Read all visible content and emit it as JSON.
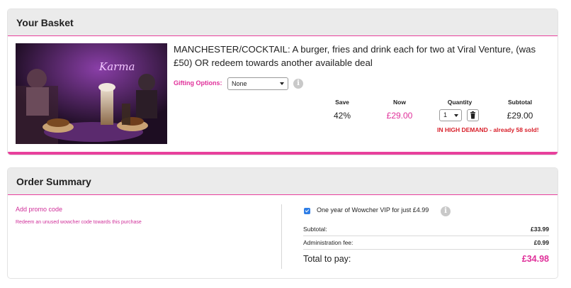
{
  "basket": {
    "header": "Your Basket",
    "deal_title": "MANCHESTER/COCKTAIL: A burger, fries and drink each for two at Viral Venture, (was £50) OR redeem towards another available deal",
    "image_sign_text": "Karma",
    "gifting": {
      "label": "Gifting Options:",
      "selected": "None"
    },
    "columns": {
      "save": "Save",
      "now": "Now",
      "quantity": "Quantity",
      "subtotal": "Subtotal"
    },
    "values": {
      "save": "42%",
      "now": "£29.00",
      "quantity": "1",
      "subtotal": "£29.00"
    },
    "demand_notice": "IN HIGH DEMAND - already 58 sold!"
  },
  "summary": {
    "header": "Order Summary",
    "promo_link": "Add promo code",
    "redeem_link": "Redeem an unused wowcher code towards this purchase",
    "vip_option": {
      "label": "One year of Wowcher VIP for just £4.99",
      "checked": true
    },
    "subtotal": {
      "label": "Subtotal:",
      "value": "£33.99"
    },
    "admin_fee": {
      "label": "Administration fee:",
      "value": "£0.99"
    },
    "total": {
      "label": "Total to pay:",
      "value": "£34.98"
    }
  },
  "colors": {
    "accent": "#e8409c",
    "alert": "#d81f2a",
    "checkbox": "#2f7ee6"
  },
  "icons": [
    "info-icon",
    "trash-icon",
    "chevron-down-icon",
    "checkbox-checked-icon"
  ]
}
